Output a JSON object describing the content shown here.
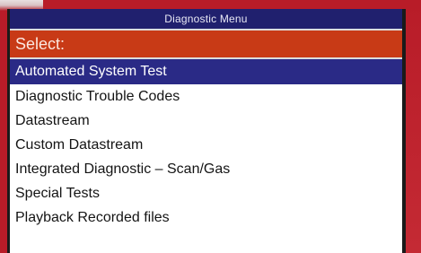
{
  "window": {
    "title": "Diagnostic Menu"
  },
  "prompt": {
    "label": "Select:"
  },
  "menu": {
    "items": [
      {
        "label": "Automated System Test",
        "selected": true
      },
      {
        "label": "Diagnostic Trouble Codes",
        "selected": false
      },
      {
        "label": "Datastream",
        "selected": false
      },
      {
        "label": "Custom Datastream",
        "selected": false
      },
      {
        "label": "Integrated Diagnostic – Scan/Gas",
        "selected": false
      },
      {
        "label": "Special Tests",
        "selected": false
      },
      {
        "label": "Playback Recorded files",
        "selected": false
      }
    ]
  },
  "colors": {
    "title_bar": "#20206e",
    "select_bar": "#c83a16",
    "selected_item": "#2a2a86",
    "device_body": "#b81c28"
  }
}
